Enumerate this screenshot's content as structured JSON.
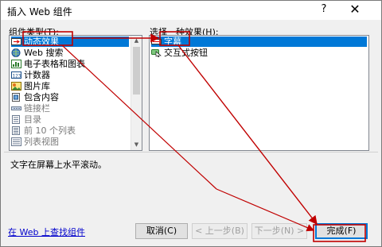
{
  "window": {
    "title": "插入 Web 组件",
    "help_glyph": "?",
    "close_glyph": "✕"
  },
  "categories": {
    "label": "组件类型(T):",
    "items": [
      {
        "label": "动态效果",
        "icon": "motion-icon",
        "selected": true,
        "enabled": true
      },
      {
        "label": "Web 搜索",
        "icon": "web-search-icon",
        "selected": false,
        "enabled": true
      },
      {
        "label": "电子表格和图表",
        "icon": "spreadsheet-icon",
        "selected": false,
        "enabled": true
      },
      {
        "label": "计数器",
        "icon": "counter-icon",
        "selected": false,
        "enabled": true
      },
      {
        "label": "图片库",
        "icon": "photo-gallery-icon",
        "selected": false,
        "enabled": true
      },
      {
        "label": "包含内容",
        "icon": "included-content-icon",
        "selected": false,
        "enabled": true
      },
      {
        "label": "链接栏",
        "icon": "link-bar-icon",
        "selected": false,
        "enabled": false
      },
      {
        "label": "目录",
        "icon": "toc-icon",
        "selected": false,
        "enabled": false
      },
      {
        "label": "前 10 个列表",
        "icon": "top10-list-icon",
        "selected": false,
        "enabled": false
      },
      {
        "label": "列表视图",
        "icon": "list-view-icon",
        "selected": false,
        "enabled": false
      }
    ]
  },
  "effects": {
    "label": "选择一种效果(H):",
    "items": [
      {
        "label": "字幕",
        "icon": "marquee-icon",
        "selected": true
      },
      {
        "label": "交互式按钮",
        "icon": "interactive-button-icon",
        "selected": false
      }
    ]
  },
  "description": "文字在屏幕上水平滚动。",
  "link": "在 Web 上查找组件",
  "buttons": {
    "cancel": "取消(C)",
    "back": "< 上一步(B)",
    "next": "下一步(N) >",
    "finish": "完成(F)"
  },
  "colors": {
    "selection": "#0078d7",
    "annotation": "#c00000",
    "link": "#0000cc"
  }
}
